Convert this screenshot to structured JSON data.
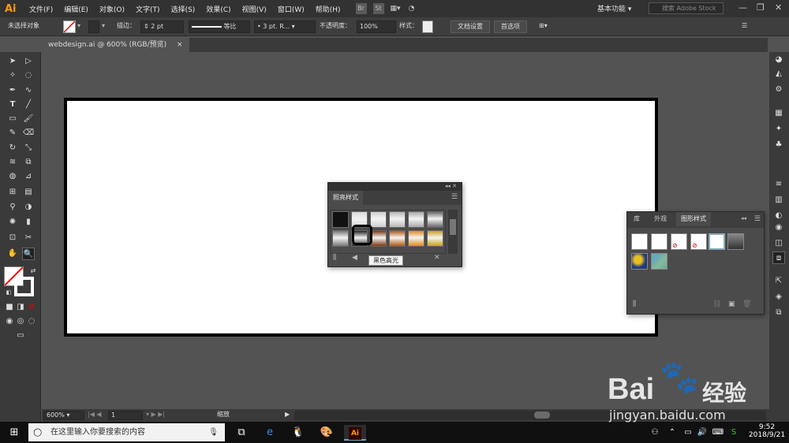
{
  "menubar": {
    "logo": "Ai",
    "items": [
      "文件(F)",
      "编辑(E)",
      "对象(O)",
      "文字(T)",
      "选择(S)",
      "效果(C)",
      "视图(V)",
      "窗口(W)",
      "帮助(H)"
    ],
    "br_label": "Br",
    "st_label": "St",
    "workspace": "基本功能",
    "search_placeholder": "搜索 Adobe Stock"
  },
  "control": {
    "selection": "未选择对象",
    "stroke_label": "描边：",
    "stroke_value": "2 pt",
    "profile": "等比",
    "brush": "3 pt. R...",
    "opacity_label": "不透明度：",
    "opacity_value": "100%",
    "style_label": "样式：",
    "doc_setup": "文档设置",
    "prefs": "首选项"
  },
  "document": {
    "tab": "webdesign.ai @ 600% (RGB/预览)",
    "close": "×"
  },
  "panel1": {
    "title": "照亮样式",
    "tooltip": "黑色高光",
    "row1": [
      "#111111",
      "#d8d8d8",
      "#cfcfcf",
      "#b8b8b8",
      "#a8a8a8",
      "#6a6a6a"
    ],
    "row2": [
      "#777777",
      "#222222",
      "#7a3a10",
      "#b05a10",
      "#e08a20",
      "#c8a020"
    ]
  },
  "panel2": {
    "tabs": [
      "库",
      "外观",
      "图形样式"
    ],
    "styles": [
      "default",
      "basic",
      "no-stroke-1",
      "no-stroke-2",
      "blue-outline",
      "dark-gradient",
      "yellow-pattern",
      "teal-pattern"
    ]
  },
  "status": {
    "zoom": "600%",
    "page": "1",
    "mode": "缩放"
  },
  "taskbar": {
    "search": "在这里输入你要搜索的内容",
    "time": "9:52",
    "date": "2018/9/21",
    "ai_label": "Ai"
  },
  "watermark": {
    "brand": "Bai",
    "brand2": "经验",
    "url": "jingyan.baidu.com"
  }
}
